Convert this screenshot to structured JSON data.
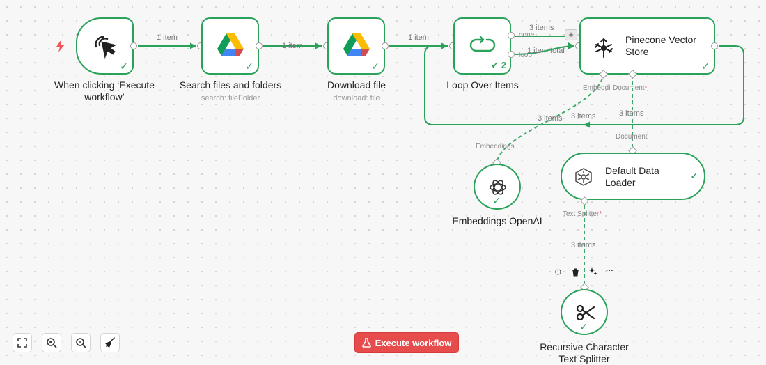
{
  "colors": {
    "success": "#2aa25a",
    "accent": "#e74c4c",
    "dash": "#3aa866"
  },
  "nodes": {
    "trigger": {
      "title": "When clicking ‘Execute workflow’",
      "icon": "cursor-click-icon"
    },
    "search": {
      "title": "Search files and folders",
      "subtitle": "search: fileFolder",
      "icon": "google-drive-icon"
    },
    "download": {
      "title": "Download file",
      "subtitle": "download: file",
      "icon": "google-drive-icon"
    },
    "loop": {
      "title": "Loop Over Items",
      "count": "2",
      "icon": "loop-icon",
      "output_done": "done",
      "output_loop": "loop"
    },
    "pinecone": {
      "title_line1": "Pinecone Vector",
      "title_line2": "Store",
      "icon": "pinecone-icon",
      "input_embedding": "Embeddi",
      "input_document": "Document"
    },
    "loader": {
      "title_line1": "Default Data",
      "title_line2": "Loader",
      "icon": "hexagon-icon",
      "input_document": "Document",
      "input_splitter": "Text Splitter"
    },
    "embeddings": {
      "title": "Embeddings OpenAI",
      "icon": "openai-icon",
      "output_label": "Embeddings"
    },
    "splitter": {
      "title_line1": "Recursive Character",
      "title_line2": "Text Splitter",
      "icon": "scissors-icon"
    }
  },
  "edges": {
    "trigger_search": "1 item",
    "search_download": "1 item",
    "download_loop": "1 item",
    "loop_done": "3 items",
    "loop_loop": "1 item total",
    "back_left": "3 items",
    "back_right": "3 items",
    "emb_to_pinecone": "3 items",
    "doc_to_pinecone": "3 items",
    "splitter_to_loader": "3 items"
  },
  "required_marker": "*",
  "plus": "+",
  "node_toolbar": {
    "power": "⏻",
    "delete": "🗑",
    "more": "···"
  },
  "canvas_controls": {
    "fit": "fit-view-icon",
    "zoom_in": "zoom-in-icon",
    "zoom_out": "zoom-out-icon",
    "tidy": "broom-icon"
  },
  "execute_button": {
    "label": "Execute workflow",
    "icon": "flask-icon"
  }
}
